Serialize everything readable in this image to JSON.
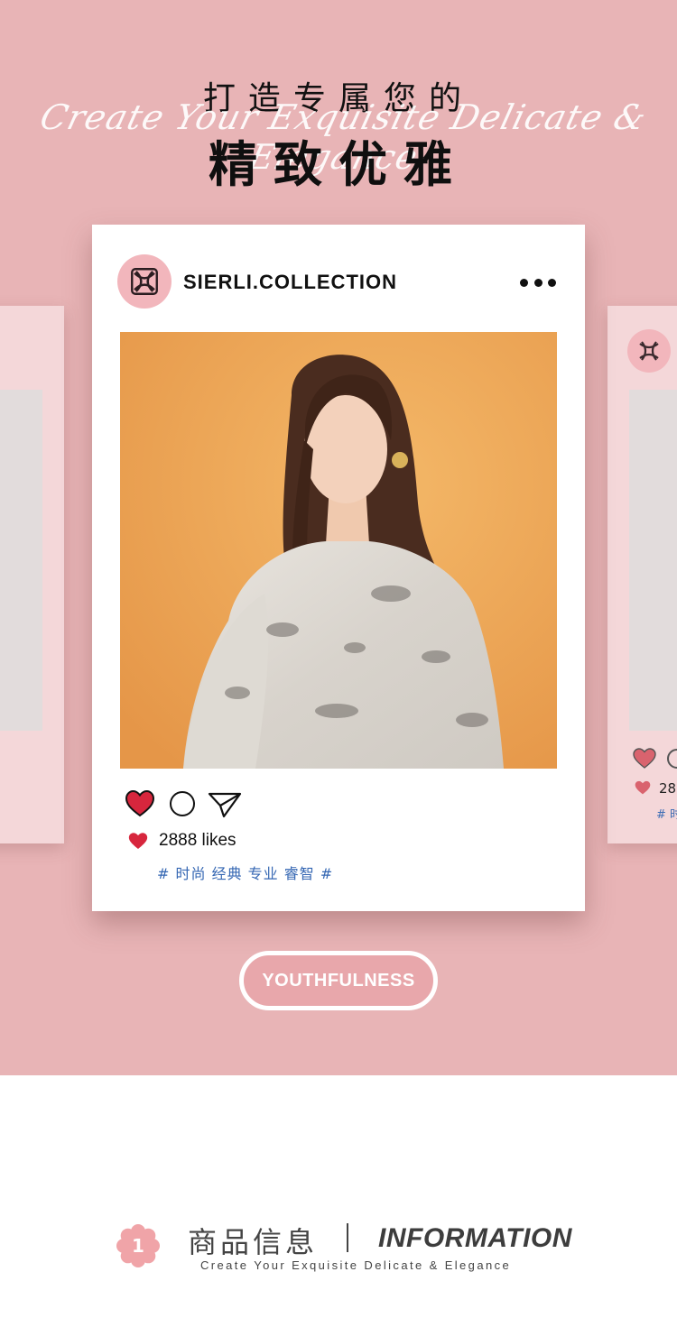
{
  "hero": {
    "title_top": "打造专属您的",
    "script_line": "Create Your Exquisite Delicate & Elegance",
    "title_main": "精致优雅"
  },
  "post": {
    "handle": "SIERLI.COLLECTION",
    "more_icon": "more-dots-icon",
    "likes": "2888 likes",
    "tags": "# 时尚 经典 专业 睿智 #"
  },
  "side_card": {
    "likes_partial": "28",
    "tags_partial": "# 时"
  },
  "badge": {
    "label": "YOUTHFULNESS"
  },
  "info": {
    "number": "1",
    "title_cn": "商品信息",
    "title_en": "INFORMATION",
    "subtitle": "Create Your Exquisite Delicate & Elegance"
  },
  "colors": {
    "background": "#e8b4b6",
    "card": "#ffffff",
    "accent_pink": "#f2b6bc",
    "heart_red": "#d7263d",
    "tag_blue": "#3567b3"
  }
}
